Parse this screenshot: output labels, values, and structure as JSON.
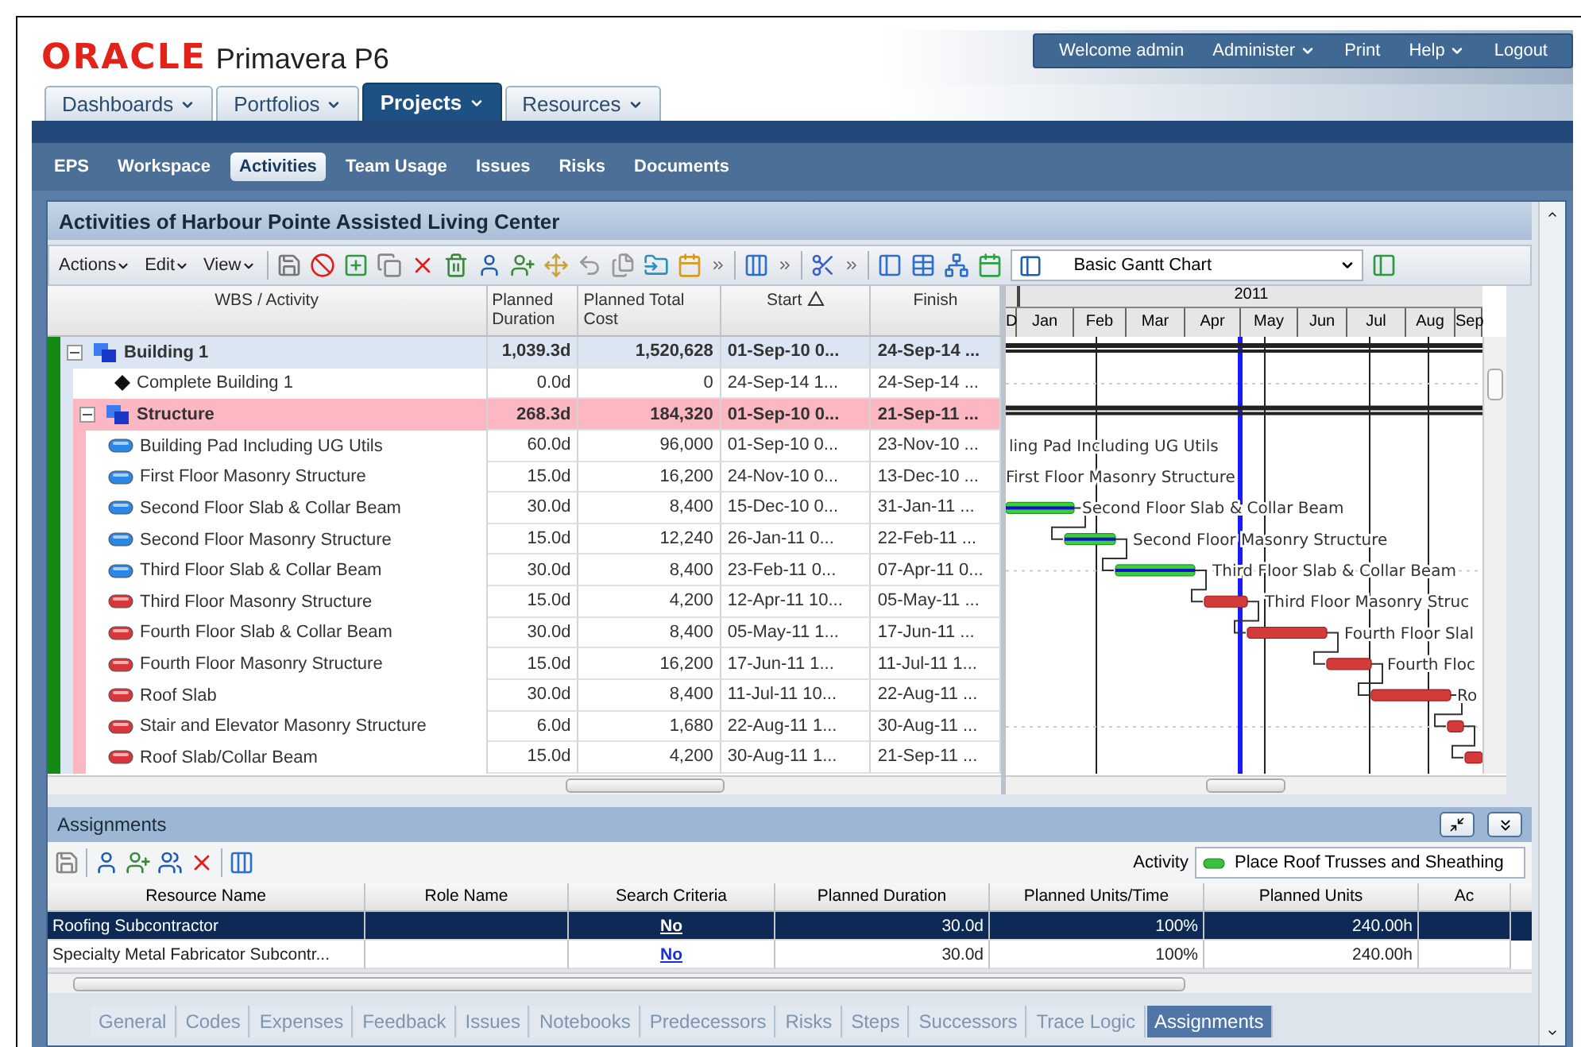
{
  "header": {
    "brand": "ORACLE",
    "product": "Primavera P6",
    "user_menu": [
      {
        "label": "Welcome admin",
        "menu": false
      },
      {
        "label": "Administer",
        "menu": true
      },
      {
        "label": "Print",
        "menu": false
      },
      {
        "label": "Help",
        "menu": true
      },
      {
        "label": "Logout",
        "menu": false
      }
    ]
  },
  "main_tabs": [
    {
      "label": "Dashboards",
      "selected": false
    },
    {
      "label": "Portfolios",
      "selected": false
    },
    {
      "label": "Projects",
      "selected": true
    },
    {
      "label": "Resources",
      "selected": false
    }
  ],
  "sub_nav": [
    {
      "label": "EPS",
      "selected": false
    },
    {
      "label": "Workspace",
      "selected": false
    },
    {
      "label": "Activities",
      "selected": true
    },
    {
      "label": "Team Usage",
      "selected": false
    },
    {
      "label": "Issues",
      "selected": false
    },
    {
      "label": "Risks",
      "selected": false
    },
    {
      "label": "Documents",
      "selected": false
    }
  ],
  "panel_title": "Activities of Harbour Pointe Assisted Living Center",
  "toolbar": {
    "menus": [
      "Actions",
      "Edit",
      "View"
    ],
    "layout": "Basic Gantt Chart"
  },
  "activity_table": {
    "columns": [
      {
        "label": "WBS / Activity",
        "sorted": false
      },
      {
        "label": "Planned Duration",
        "sorted": false
      },
      {
        "label": "Planned Total Cost",
        "sorted": false
      },
      {
        "label": "Start",
        "sorted": true
      },
      {
        "label": "Finish",
        "sorted": false
      }
    ],
    "rows": [
      {
        "kind": "wbs",
        "name": "Building 1",
        "duration": "1,039.3d",
        "cost": "1,520,628",
        "start": "01-Sep-10 0...",
        "finish": "24-Sep-14 ...",
        "color": "#dce6f2",
        "expanded": true,
        "children": [
          {
            "kind": "milestone",
            "name": "Complete Building 1",
            "duration": "0.0d",
            "cost": "0",
            "start": "24-Sep-14 1...",
            "finish": "24-Sep-14 ..."
          },
          {
            "kind": "wbs",
            "name": "Structure",
            "duration": "268.3d",
            "cost": "184,320",
            "start": "01-Sep-10 0...",
            "finish": "21-Sep-11 ...",
            "color": "#fbb8c2",
            "expanded": true,
            "children": [
              {
                "kind": "activity",
                "name": "Building Pad Including UG Utils",
                "duration": "60.0d",
                "cost": "96,000",
                "start": "01-Sep-10 0...",
                "finish": "23-Nov-10 ...",
                "completed": true,
                "bar_label": "ling Pad Including UG Utils"
              },
              {
                "kind": "activity",
                "name": "First Floor Masonry Structure",
                "duration": "15.0d",
                "cost": "16,200",
                "start": "24-Nov-10 0...",
                "finish": "13-Dec-10 ...",
                "completed": true,
                "bar_label": "First Floor Masonry Structure"
              },
              {
                "kind": "activity",
                "name": "Second Floor Slab & Collar Beam",
                "duration": "30.0d",
                "cost": "8,400",
                "start": "15-Dec-10 0...",
                "finish": "31-Jan-11 ...",
                "completed": true,
                "bar_label": "Second Floor Slab & Collar Beam"
              },
              {
                "kind": "activity",
                "name": "Second Floor Masonry Structure",
                "duration": "15.0d",
                "cost": "12,240",
                "start": "26-Jan-11 0...",
                "finish": "22-Feb-11 ...",
                "completed": true,
                "bar_label": "Second Floor Masonry Structure"
              },
              {
                "kind": "activity",
                "name": "Third Floor Slab & Collar Beam",
                "duration": "30.0d",
                "cost": "8,400",
                "start": "23-Feb-11 0...",
                "finish": "07-Apr-11 0...",
                "completed": true,
                "bar_label": "Third Floor Slab & Collar Beam"
              },
              {
                "kind": "activity",
                "name": "Third Floor Masonry Structure",
                "duration": "15.0d",
                "cost": "4,200",
                "start": "12-Apr-11 10...",
                "finish": "05-May-11 ...",
                "completed": false,
                "bar_label": "Third Floor Masonry Struc"
              },
              {
                "kind": "activity",
                "name": "Fourth Floor Slab & Collar Beam",
                "duration": "30.0d",
                "cost": "8,400",
                "start": "05-May-11 1...",
                "finish": "17-Jun-11 ...",
                "completed": false,
                "bar_label": "Fourth Floor Slal"
              },
              {
                "kind": "activity",
                "name": "Fourth Floor Masonry Structure",
                "duration": "15.0d",
                "cost": "16,200",
                "start": "17-Jun-11 1...",
                "finish": "11-Jul-11 1...",
                "completed": false,
                "bar_label": "Fourth Floc"
              },
              {
                "kind": "activity",
                "name": "Roof Slab",
                "duration": "30.0d",
                "cost": "8,400",
                "start": "11-Jul-11 10...",
                "finish": "22-Aug-11 ...",
                "completed": false,
                "bar_label": "Ro"
              },
              {
                "kind": "activity",
                "name": "Stair and Elevator Masonry Structure",
                "duration": "6.0d",
                "cost": "1,680",
                "start": "22-Aug-11 1...",
                "finish": "30-Aug-11 ...",
                "completed": false
              },
              {
                "kind": "activity",
                "name": "Roof Slab/Collar Beam",
                "duration": "15.0d",
                "cost": "4,200",
                "start": "30-Aug-11 1...",
                "finish": "21-Sep-11 ...",
                "completed": false
              }
            ]
          }
        ]
      }
    ]
  },
  "gantt": {
    "year": "2011",
    "months": [
      "D",
      "Jan",
      "Feb",
      "Mar",
      "Apr",
      "May",
      "Jun",
      "Jul",
      "Aug",
      "Sep"
    ]
  },
  "assignments": {
    "title": "Assignments",
    "activity_label": "Activity",
    "activity": "Place Roof Trusses and Sheathing",
    "columns": [
      "Resource Name",
      "Role Name",
      "Search Criteria",
      "Planned Duration",
      "Planned Units/Time",
      "Planned Units",
      "Ac"
    ],
    "rows": [
      {
        "resource": "Roofing Subcontractor",
        "search": "No",
        "duration": "30.0d",
        "units_time": "100%",
        "units": "240.00h",
        "selected": true
      },
      {
        "resource": "Specialty Metal Fabricator Subcontr...",
        "search": "No",
        "duration": "30.0d",
        "units_time": "100%",
        "units": "240.00h",
        "selected": false
      }
    ]
  },
  "bottom_tabs": [
    {
      "label": "General",
      "selected": false
    },
    {
      "label": "Codes",
      "selected": false
    },
    {
      "label": "Expenses",
      "selected": false
    },
    {
      "label": "Feedback",
      "selected": false
    },
    {
      "label": "Issues",
      "selected": false
    },
    {
      "label": "Notebooks",
      "selected": false
    },
    {
      "label": "Predecessors",
      "selected": false
    },
    {
      "label": "Risks",
      "selected": false
    },
    {
      "label": "Steps",
      "selected": false
    },
    {
      "label": "Successors",
      "selected": false
    },
    {
      "label": "Trace Logic",
      "selected": false
    },
    {
      "label": "Assignments",
      "selected": true
    }
  ]
}
